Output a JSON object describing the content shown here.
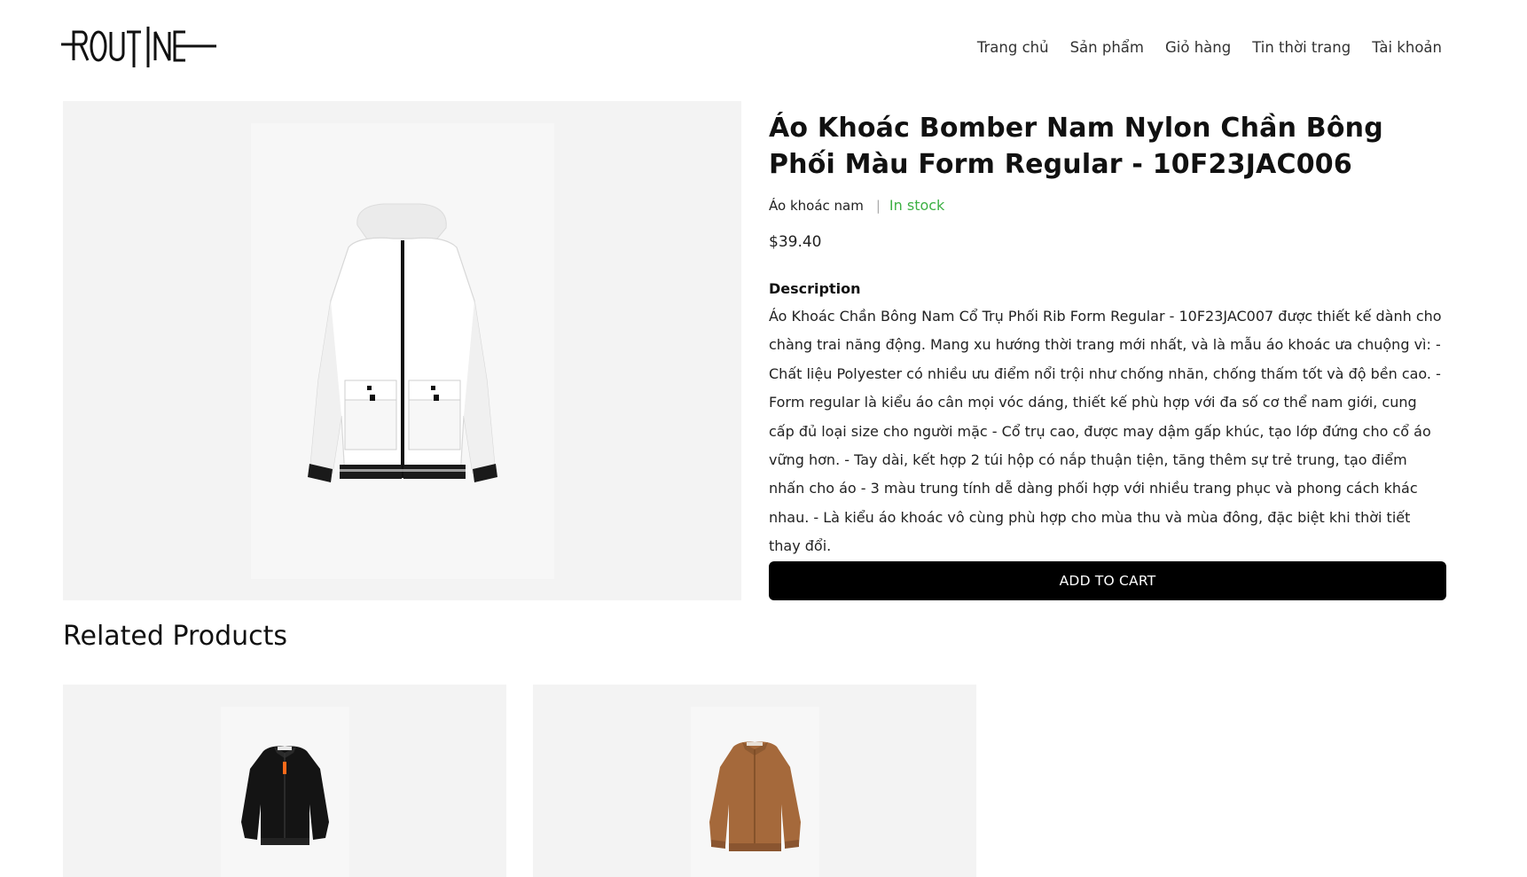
{
  "header": {
    "logo_text": "ROUTINE",
    "nav": [
      "Trang chủ",
      "Sản phẩm",
      "Giỏ hàng",
      "Tin thời trang",
      "Tài khoản"
    ]
  },
  "product": {
    "title": "Áo Khoác Bomber Nam Nylon Chần Bông Phối Màu Form Regular - 10F23JAC006",
    "category": "Áo khoác nam",
    "separator": "|",
    "stock": "In stock",
    "price": "$39.40",
    "description_label": "Description",
    "description": "Áo Khoác Chần Bông Nam Cổ Trụ Phối Rib Form Regular - 10F23JAC007 được thiết kế dành cho chàng trai năng động. Mang xu hướng thời trang mới nhất, và là mẫu áo khoác ưa chuộng vì: - Chất liệu Polyester có nhiều ưu điểm nổi trội như chống nhăn, chống thấm tốt và độ bền cao. - Form regular là kiểu áo cân mọi vóc dáng, thiết kế phù hợp với đa số cơ thể nam giới, cung cấp đủ loại size cho người mặc - Cổ trụ cao, được may dậm gấp khúc, tạo lớp đứng cho cổ áo vững hơn. - Tay dài, kết hợp 2 túi hộp có nắp thuận tiện, tăng thêm sự trẻ trung, tạo điểm nhấn cho áo - 3 màu trung tính dễ dàng phối hợp với nhiều trang phục và phong cách khác nhau. - Là kiểu áo khoác vô cùng phù hợp cho mùa thu và mùa đông, đặc biệt khi thời tiết thay đổi.",
    "add_to_cart": "ADD TO CART",
    "image_icon": "white-hooded-jacket-image"
  },
  "related": {
    "title": "Related Products",
    "items": [
      {
        "image_icon": "black-bomber-jacket-image"
      },
      {
        "image_icon": "brown-bomber-jacket-image"
      }
    ]
  },
  "colors": {
    "stock_green": "#3cb043",
    "image_bg": "#f3f3f3",
    "button_bg": "#000000"
  }
}
